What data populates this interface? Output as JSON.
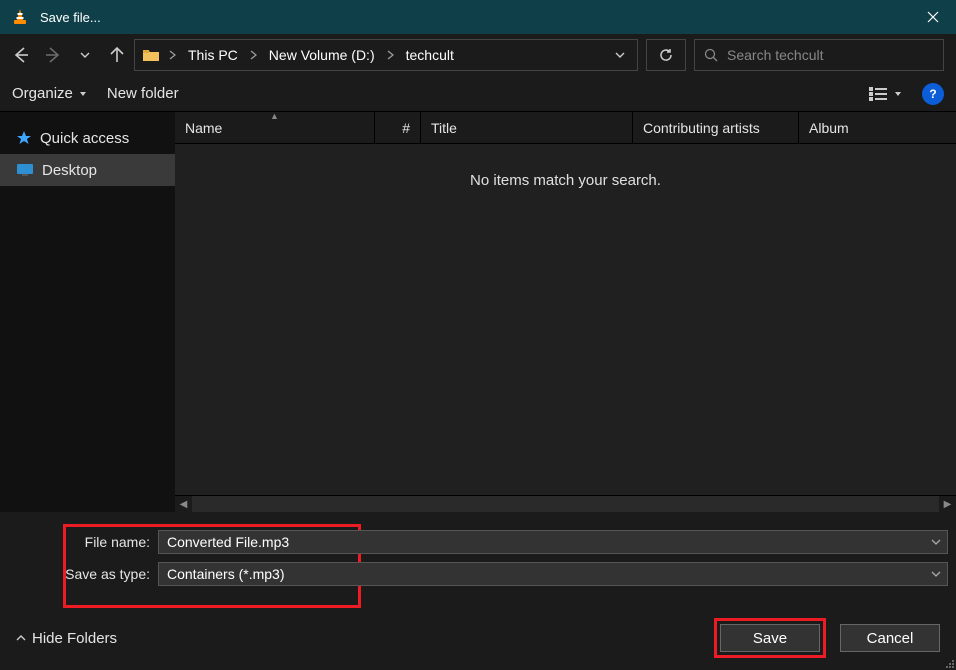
{
  "window": {
    "title": "Save file..."
  },
  "breadcrumb": {
    "items": [
      "This PC",
      "New Volume (D:)",
      "techcult"
    ]
  },
  "search": {
    "placeholder": "Search techcult"
  },
  "toolbar": {
    "organize": "Organize",
    "new_folder": "New folder"
  },
  "sidebar": {
    "items": [
      {
        "label": "Quick access",
        "icon": "star-icon"
      },
      {
        "label": "Desktop",
        "icon": "desktop-icon",
        "selected": true
      }
    ]
  },
  "columns": {
    "name": "Name",
    "num": "#",
    "title": "Title",
    "contributing": "Contributing artists",
    "album": "Album"
  },
  "list": {
    "empty_message": "No items match your search."
  },
  "form": {
    "filename_label": "File name:",
    "filename_value": "Converted File.mp3",
    "saveastype_label": "Save as type:",
    "saveastype_value": "Containers (*.mp3)"
  },
  "actions": {
    "hide_folders": "Hide Folders",
    "save": "Save",
    "cancel": "Cancel"
  },
  "help": {
    "label": "?"
  }
}
